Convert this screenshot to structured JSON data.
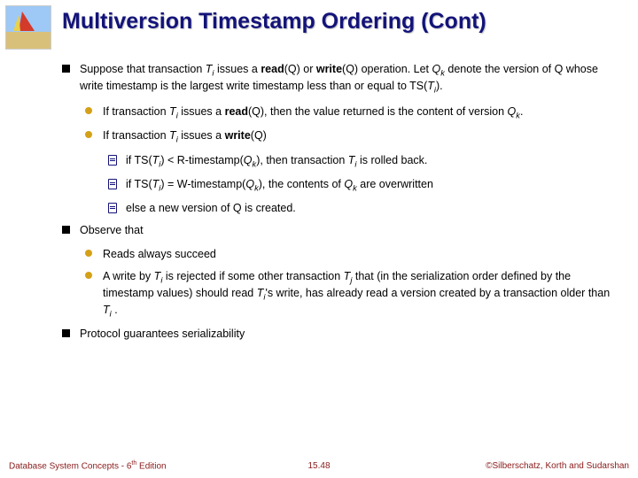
{
  "title": "Multiversion Timestamp Ordering (Cont)",
  "b1_pre": "Suppose that transaction ",
  "b1_Ti": "T",
  "b1_i": "i",
  "b1_mid1": " issues a ",
  "b1_read": "read",
  "b1_readQ": "(Q)",
  "b1_or": " or ",
  "b1_write": "write",
  "b1_writeQ": "(Q)",
  "b1_mid2": " operation.  Let ",
  "b1_Qk": "Q",
  "b1_k": "k",
  "b1_mid3": " denote the version of Q whose write timestamp is the largest write timestamp less than or equal to TS(",
  "b1_Ti2": "T",
  "b1_i2": "i",
  "b1_end": ").",
  "b1a_pre": "If transaction ",
  "b1a_Ti": "T",
  "b1a_i": "i",
  "b1a_mid": " issues a ",
  "b1a_read": "read",
  "b1a_Q": "(Q), then the value returned is the content of version ",
  "b1a_Qk": "Q",
  "b1a_k": "k",
  "b1a_end": ".",
  "b1b_pre": "If transaction ",
  "b1b_Ti": "T",
  "b1b_i": "i",
  "b1b_mid": " issues a  ",
  "b1b_write": "write",
  "b1b_Q": "(Q)",
  "b1b1_pre": "if TS(",
  "b1b1_Ti": "T",
  "b1b1_i": "i",
  "b1b1_mid": ") < R-timestamp(",
  "b1b1_Qk": "Q",
  "b1b1_k": "k",
  "b1b1_mid2": "), then transaction ",
  "b1b1_Ti2": "T",
  "b1b1_i2": "i",
  "b1b1_end": " is rolled back.",
  "b1b2_pre": "if TS(",
  "b1b2_Ti": "T",
  "b1b2_i": "i",
  "b1b2_mid": ") = W-timestamp(",
  "b1b2_Qk": "Q",
  "b1b2_k": "k",
  "b1b2_mid2": "), the contents of ",
  "b1b2_Qk2": "Q",
  "b1b2_k2": "k",
  "b1b2_end": " are overwritten",
  "b1b3": "else a new version of Q is created.",
  "b2": "Observe that",
  "b2a": "Reads always succeed",
  "b2b_pre": "A write by ",
  "b2b_Ti": "T",
  "b2b_i": "i",
  "b2b_mid1": " is rejected if some other transaction ",
  "b2b_Tj": "T",
  "b2b_j": "j",
  "b2b_mid2": " that (in the serialization order defined by the timestamp values) should read ",
  "b2b_Ti2": "T",
  "b2b_i2": "i",
  "b2b_mid3": "'s write, has already read a version created by a transaction older than ",
  "b2b_Ti3": "T",
  "b2b_i3": "i",
  "b2b_end": " .",
  "b3": "Protocol guarantees serializability",
  "footer_left_a": "Database System Concepts - 6",
  "footer_left_b": "th",
  "footer_left_c": " Edition",
  "footer_center": "15.48",
  "footer_right": "©Silberschatz, Korth and Sudarshan"
}
